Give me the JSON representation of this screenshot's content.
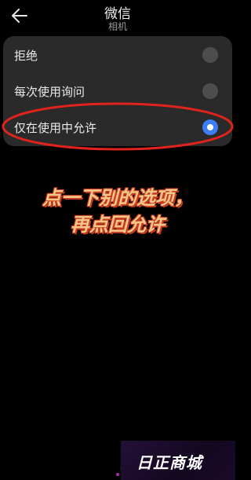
{
  "header": {
    "title": "微信",
    "subtitle": "相机"
  },
  "options": [
    {
      "label": "拒绝",
      "selected": false
    },
    {
      "label": "每次使用询问",
      "selected": false
    },
    {
      "label": "仅在使用中允许",
      "selected": true
    }
  ],
  "caption": {
    "line1": "点一下别的选项，",
    "line2": "再点回允许"
  },
  "watermark": {
    "text": "日正商城"
  },
  "colors": {
    "background": "#000000",
    "card": "#2a2a2a",
    "accent": "#3d7cf2",
    "annotation": "#e0231c",
    "caption_fill": "#f4c68a",
    "caption_outline": "#c93a1e"
  }
}
